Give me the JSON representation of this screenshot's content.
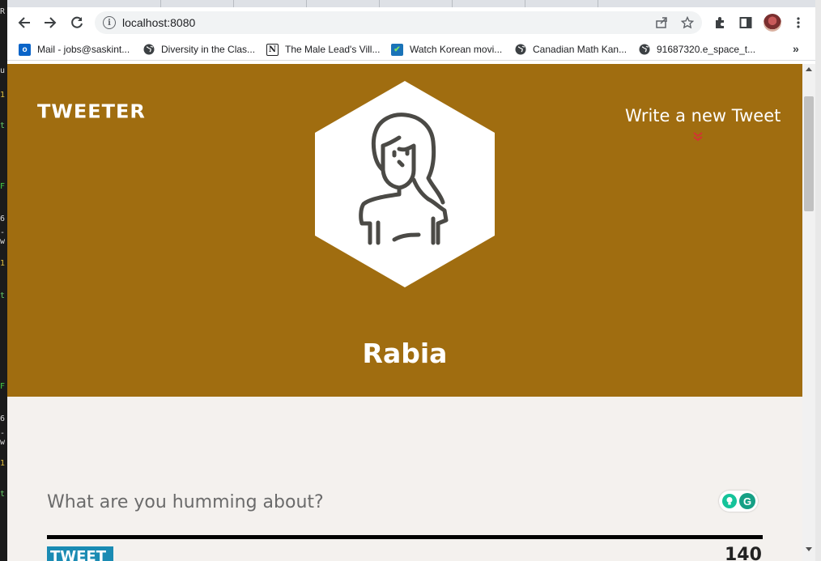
{
  "browser": {
    "url": "localhost:8080",
    "bookmarks": [
      {
        "label": "Mail - jobs@saskint...",
        "icon": "outlook-icon"
      },
      {
        "label": "Diversity in the Clas...",
        "icon": "globe-icon"
      },
      {
        "label": "The Male Lead's Vill...",
        "icon": "notion-icon"
      },
      {
        "label": "Watch Korean movi...",
        "icon": "checkbox-icon"
      },
      {
        "label": "Canadian Math Kan...",
        "icon": "globe-icon"
      },
      {
        "label": "91687320.e_space_t...",
        "icon": "globe-icon"
      }
    ],
    "more": "»"
  },
  "page": {
    "logo": "TWEETER",
    "write_new_tweet": "Write a new Tweet",
    "username": "Rabia",
    "compose_placeholder": "What are you humming about?",
    "tweet_button": "TWEET",
    "char_counter": "140"
  },
  "colors": {
    "hero": "#a06d10",
    "page_bg": "#f4f1ee",
    "tweet_button": "#1a8bb3",
    "chevron": "#d33333"
  }
}
